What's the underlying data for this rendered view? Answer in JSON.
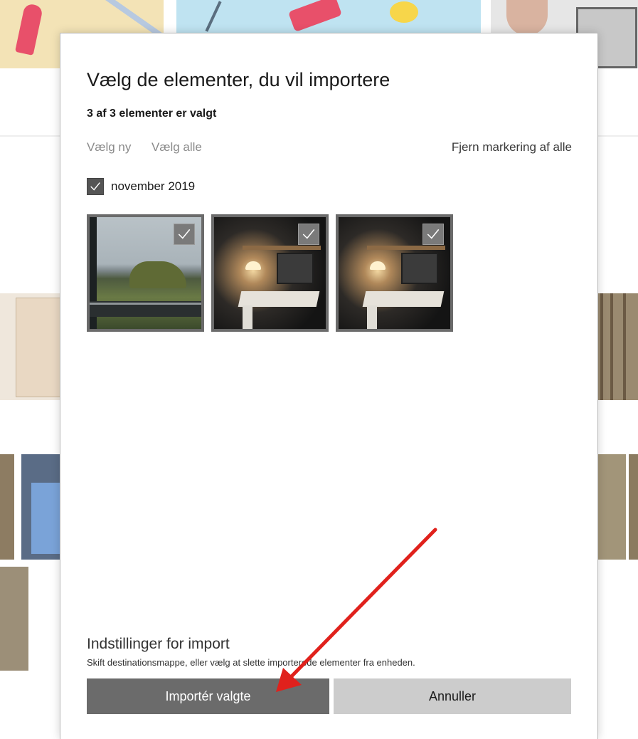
{
  "dialog": {
    "title": "Vælg de elementer, du vil importere",
    "selection_count": "3 af 3 elementer er valgt",
    "links": {
      "select_new": "Vælg ny",
      "select_all": "Vælg alle",
      "deselect_all": "Fjern markering af alle"
    },
    "group": {
      "label": "november 2019",
      "checked": true
    },
    "thumbnails": [
      {
        "subject": "outdoor landscape photo",
        "checked": true
      },
      {
        "subject": "desk with lamp photo",
        "checked": true
      },
      {
        "subject": "desk with lamp photo",
        "checked": true
      }
    ],
    "import_settings": {
      "title": "Indstillinger for import",
      "description": "Skift destinationsmappe, eller vælg at slette importerede elementer fra enheden."
    },
    "buttons": {
      "import": "Importér valgte",
      "cancel": "Annuller"
    }
  },
  "annotation": {
    "type": "red arrow pointing to import button",
    "color": "#e0211c"
  },
  "colors": {
    "primary_button": "#6b6b6b",
    "secondary_button": "#cccccc",
    "checkbox": "#555555"
  }
}
